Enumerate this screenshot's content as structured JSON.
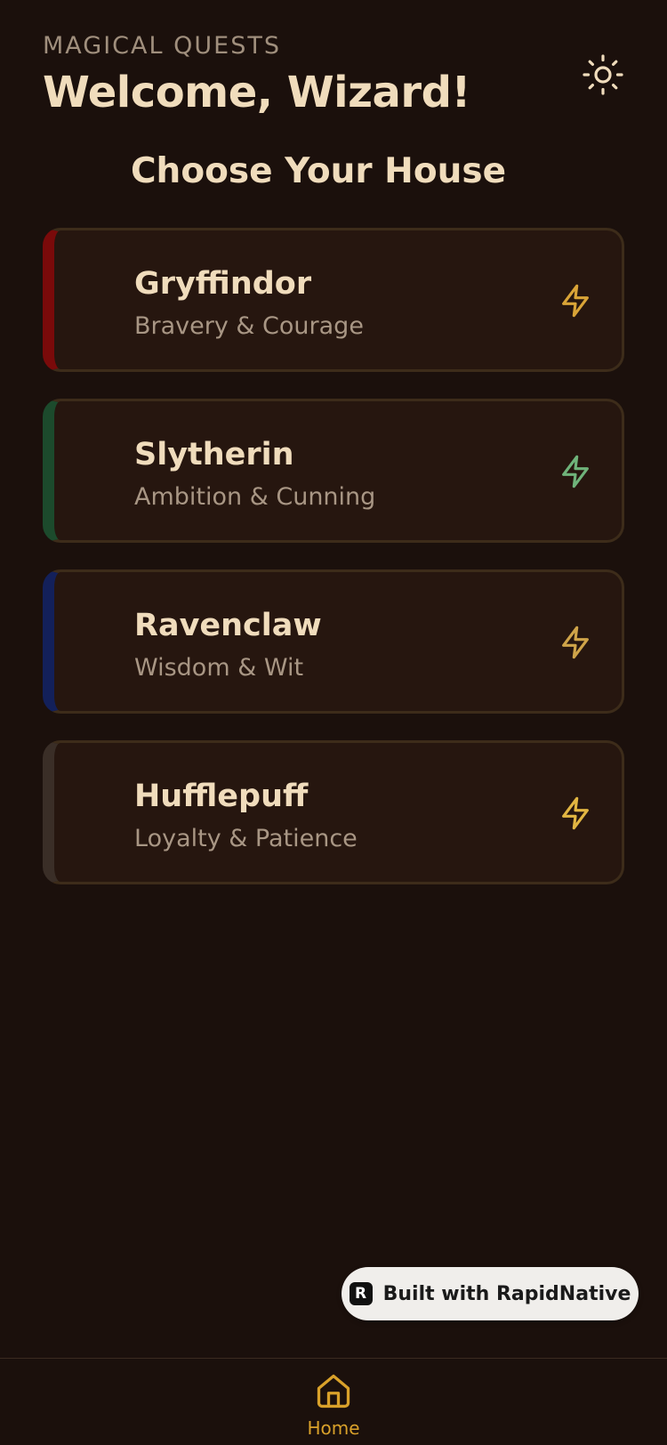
{
  "header": {
    "subtitle": "MAGICAL QUESTS",
    "title": "Welcome, Wizard!",
    "theme_toggle_icon": "sun-icon"
  },
  "section": {
    "title": "Choose Your House"
  },
  "houses": [
    {
      "name": "Gryffindor",
      "trait": "Bravery & Courage",
      "accent": "#7a0a0a",
      "bolt_color": "#d9a437",
      "icon": "lightning-icon"
    },
    {
      "name": "Slytherin",
      "trait": "Ambition & Cunning",
      "accent": "#1c4a2c",
      "bolt_color": "#6fb37a",
      "icon": "lightning-icon"
    },
    {
      "name": "Ravenclaw",
      "trait": "Wisdom & Wit",
      "accent": "#13205a",
      "bolt_color": "#cfa449",
      "icon": "lightning-icon"
    },
    {
      "name": "Hufflepuff",
      "trait": "Loyalty & Patience",
      "accent": "#3a2e27",
      "bolt_color": "#e2b642",
      "icon": "lightning-icon"
    }
  ],
  "badge": {
    "logo": "R",
    "label": "Built with RapidNative"
  },
  "tabbar": {
    "home_label": "Home",
    "home_icon": "home-icon",
    "active_color": "#d9a12a"
  },
  "colors": {
    "background": "#1b100c",
    "card_background": "#26160f",
    "card_border": "#3d2c1a",
    "title_text": "#f0dcbc",
    "muted_text": "#a89684"
  }
}
